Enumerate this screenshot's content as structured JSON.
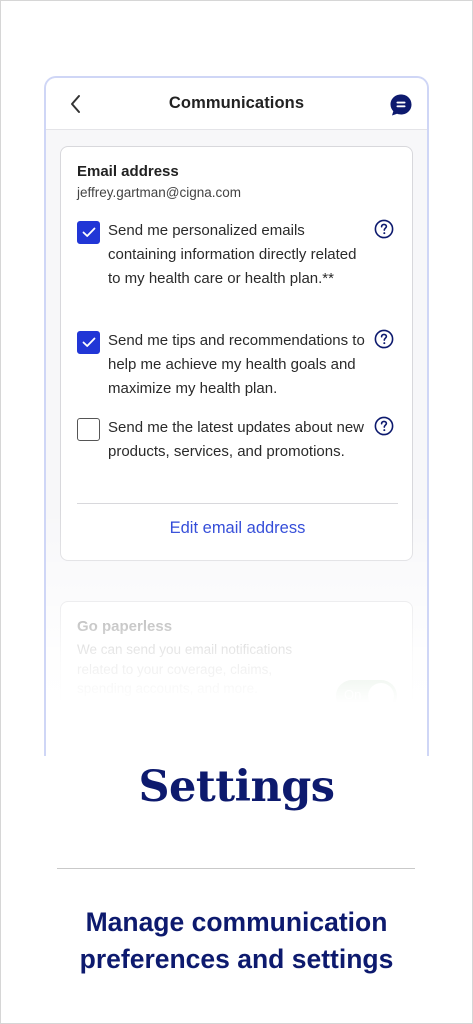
{
  "appbar": {
    "title": "Communications"
  },
  "email_card": {
    "title": "Email address",
    "email": "jeffrey.gartman@cigna.com",
    "preferences": [
      {
        "text": "Send me personalized emails containing information directly related to my health care or health plan.**",
        "checked": true
      },
      {
        "text": "Send me tips and recommendations to help me achieve my health goals and maximize my health plan.",
        "checked": true
      },
      {
        "text": "Send me the latest updates about new products, services, and promotions.",
        "checked": false
      }
    ],
    "edit_link": "Edit email address"
  },
  "paperless_card": {
    "title": "Go paperless",
    "description": "We can send you email notifications related to your coverage, claims, spending accounts, and more. Paperless notifications are faster and easy to access when you need them.",
    "toggle_label": "On",
    "toggle_on": true
  },
  "marketing": {
    "headline": "Settings",
    "subhead": "Manage communication preferences and settings"
  },
  "colors": {
    "accent": "#2136d6",
    "link": "#1b37d4",
    "brand_navy": "#0d1a6e",
    "toggle_on": "#3a8a3a"
  },
  "icons": {
    "back": "chevron-left-icon",
    "chat": "chat-bubble-icon",
    "help": "question-circle-icon",
    "check": "checkmark-icon"
  }
}
